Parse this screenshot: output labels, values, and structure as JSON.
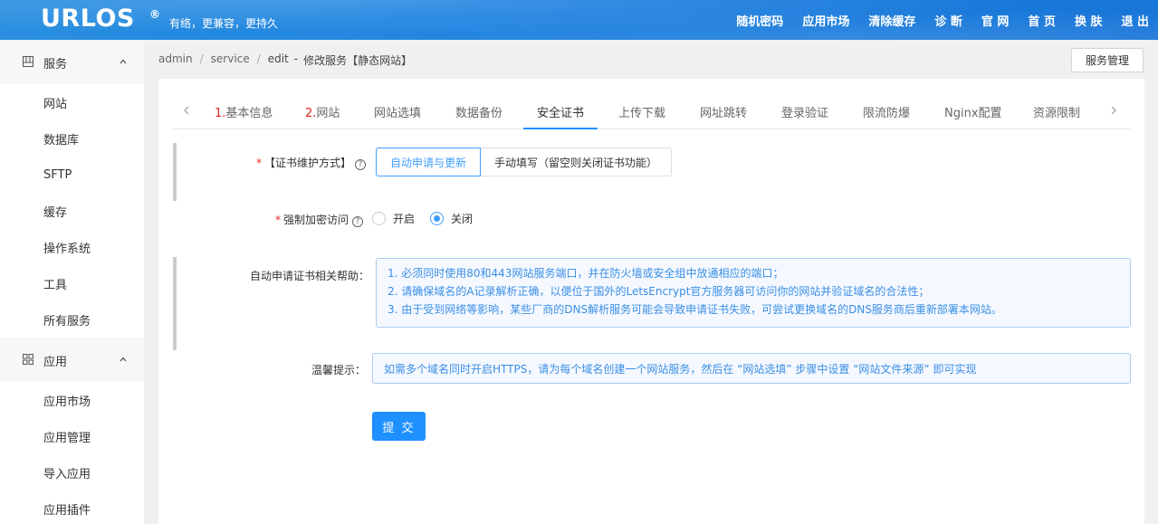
{
  "header": {
    "logo": "URLOS",
    "logo_mark": "®",
    "slogan": "有络，更兼容，更持久",
    "nav": [
      "随机密码",
      "应用市场",
      "清除缓存",
      "诊 断",
      "官 网",
      "首 页",
      "换 肤",
      "退 出"
    ]
  },
  "sidebar": {
    "groups": [
      {
        "label": "服务",
        "icon": "service-grid-icon",
        "items": [
          "网站",
          "数据库",
          "SFTP",
          "缓存",
          "操作系统",
          "工具",
          "所有服务"
        ]
      },
      {
        "label": "应用",
        "icon": "apps-grid-icon",
        "items": [
          "应用市场",
          "应用管理",
          "导入应用",
          "应用插件"
        ]
      }
    ]
  },
  "breadcrumb": {
    "items": [
      "admin",
      "service",
      "edit"
    ],
    "current": "修改服务【静态网站】",
    "dash": "-"
  },
  "service_manage_button": "服务管理",
  "tabs": [
    {
      "num": "1.",
      "label": "基本信息"
    },
    {
      "num": "2.",
      "label": "网站"
    },
    {
      "num": "",
      "label": "网站选填"
    },
    {
      "num": "",
      "label": "数据备份"
    },
    {
      "num": "",
      "label": "安全证书"
    },
    {
      "num": "",
      "label": "上传下载"
    },
    {
      "num": "",
      "label": "网址跳转"
    },
    {
      "num": "",
      "label": "登录验证"
    },
    {
      "num": "",
      "label": "限流防爆"
    },
    {
      "num": "",
      "label": "Nginx配置"
    },
    {
      "num": "",
      "label": "资源限制"
    }
  ],
  "active_tab": "安全证书",
  "form": {
    "cert_mode": {
      "label": "【证书维护方式】",
      "options": [
        "自动申请与更新",
        "手动填写（留空则关闭证书功能）"
      ],
      "selected": "自动申请与更新"
    },
    "force_https": {
      "label": "强制加密访问",
      "options": [
        "开启",
        "关闭"
      ],
      "selected": "关闭"
    },
    "help": {
      "label": "自动申请证书相关帮助：",
      "lines": [
        "1. 必须同时使用80和443网站服务端口，并在防火墙或安全组中放通相应的端口；",
        "2. 请确保域名的A记录解析正确，以便位于国外的LetsEncrypt官方服务器可访问你的网站并验证域名的合法性；",
        "3. 由于受到网络等影响，某些厂商的DNS解析服务可能会导致申请证书失败，可尝试更换域名的DNS服务商后重新部署本网站。"
      ]
    },
    "tip": {
      "label": "温馨提示：",
      "text": "如需多个域名同时开启HTTPS，请为每个域名创建一个网站服务，然后在 “网站选填” 步骤中设置 “网站文件来源” 即可实现"
    },
    "submit": "提 交"
  },
  "colors": {
    "header": "#1a80e0",
    "primary": "#1e90ff",
    "accent": "#409eff",
    "required": "#e2231a"
  }
}
